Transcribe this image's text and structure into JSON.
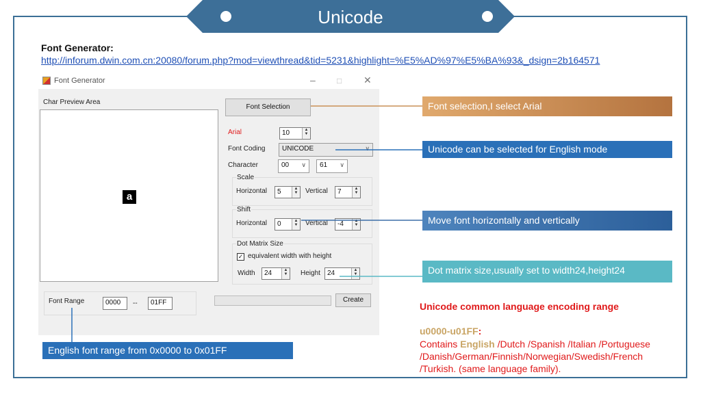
{
  "slide": {
    "title": "Unicode",
    "font_generator_label": "Font Generator:",
    "font_generator_link": "http://inforum.dwin.com.cn:20080/forum.php?mod=viewthread&tid=5231&highlight=%E5%AD%97%E5%BA%93&_dsign=2b164571"
  },
  "window": {
    "title": "Font Generator",
    "controls": {
      "minimize": "–",
      "maximize": "□",
      "close": "✕"
    },
    "preview_area_label": "Char Preview Area",
    "preview_char": "a",
    "font_selection_button": "Font Selection",
    "font_name": "Arial",
    "font_size": "10",
    "font_coding_label": "Font Coding",
    "font_coding_value": "UNICODE",
    "character_label": "Character",
    "character_high": "00",
    "character_low": "61",
    "scale": {
      "label": "Scale",
      "horizontal_label": "Horizontal",
      "horizontal_value": "5",
      "vertical_label": "Vertical",
      "vertical_value": "7"
    },
    "shift": {
      "label": "Shift",
      "horizontal_label": "Horizontal",
      "horizontal_value": "0",
      "vertical_label": "Vertical",
      "vertical_value": "-4"
    },
    "dot_matrix": {
      "label": "Dot Matrix Size",
      "equivalent_label": "equivalent width with height",
      "equivalent_checked": true,
      "width_label": "Width",
      "width_value": "24",
      "height_label": "Height",
      "height_value": "24"
    },
    "font_range": {
      "label": "Font Range",
      "from": "0000",
      "separator": "--",
      "to": "01FF"
    },
    "create_button": "Create"
  },
  "callouts": {
    "font_selection": "Font selection,I select Arial",
    "unicode_mode": "Unicode can be selected for English mode",
    "move_font": "Move font horizontally and vertically",
    "dot_matrix": "Dot matrix size,usually set to width24,height24",
    "english_range": "English font range from 0x0000 to 0x01FF"
  },
  "info": {
    "title": "Unicode common language encoding range",
    "range": "u0000-u01FF",
    "range_colon": ":",
    "contains": "Contains ",
    "english": "English",
    "languages": " /Dutch /Spanish /Italian /Portuguese /Danish/German/Finnish/Norwegian/Swedish/French /Turkish. (same language family)."
  },
  "colors": {
    "frame": "#3b6f96",
    "banner": "#3d6f98",
    "callout_font_selection": "#c98f56",
    "callout_unicode": "#2a70b8",
    "callout_move": "#3d6fa8",
    "callout_dot_matrix": "#5ab9c5",
    "callout_english": "#2a70b8",
    "info_red": "#e0191a",
    "info_gold": "#c9a565"
  }
}
